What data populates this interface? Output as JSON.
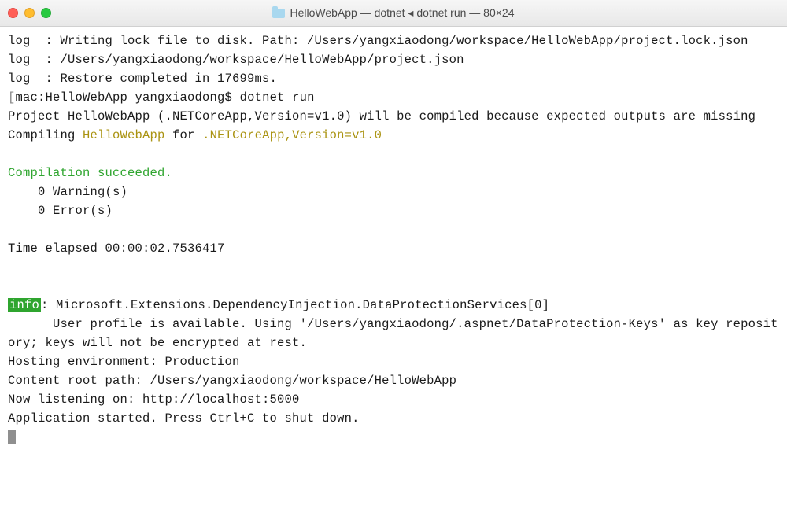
{
  "window": {
    "title": "HelloWebApp — dotnet ◂ dotnet run — 80×24"
  },
  "lines": {
    "l1": "log  : Writing lock file to disk. Path: /Users/yangxiaodong/workspace/HelloWebApp/project.lock.json",
    "l2": "log  : /Users/yangxiaodong/workspace/HelloWebApp/project.json",
    "l3": "log  : Restore completed in 17699ms.",
    "prompt_open": "[",
    "prompt": "mac:HelloWebApp yangxiaodong$ ",
    "cmd": "dotnet run",
    "prompt_close": "]",
    "l5": "Project HelloWebApp (.NETCoreApp,Version=v1.0) will be compiled because expected outputs are missing",
    "l6a": "Compiling ",
    "l6b": "HelloWebApp",
    "l6c": " for ",
    "l6d": ".NETCoreApp,Version=v1.0",
    "blank": "",
    "l8": "Compilation succeeded.",
    "l9": "    0 Warning(s)",
    "l10": "    0 Error(s)",
    "l12": "Time elapsed 00:00:02.7536417",
    "info_label": "info",
    "l15a": ": Microsoft.Extensions.DependencyInjection.DataProtectionServices[0]",
    "l16": "      User profile is available. Using '/Users/yangxiaodong/.aspnet/DataProtection-Keys' as key repository; keys will not be encrypted at rest.",
    "l17": "Hosting environment: Production",
    "l18": "Content root path: /Users/yangxiaodong/workspace/HelloWebApp",
    "l19": "Now listening on: http://localhost:5000",
    "l20": "Application started. Press Ctrl+C to shut down."
  }
}
